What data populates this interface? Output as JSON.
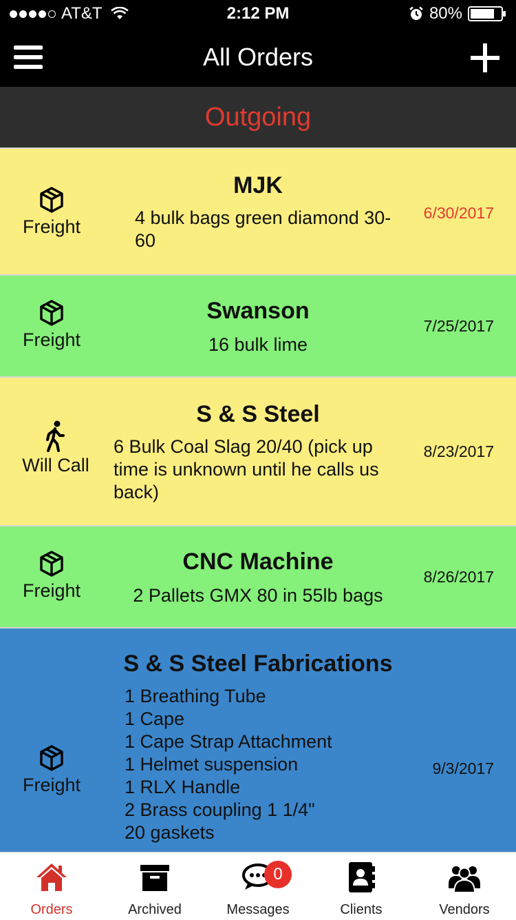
{
  "status_bar": {
    "carrier": "AT&T",
    "time": "2:12 PM",
    "battery": "80%",
    "signal_bars": 4,
    "battery_level": 0.8
  },
  "nav": {
    "title": "All Orders",
    "menu_icon": "hamburger-menu-icon",
    "add_icon": "plus-icon"
  },
  "section": {
    "title": "Outgoing"
  },
  "colors": {
    "yellow": "#fbee80",
    "green": "#85f07a",
    "blue": "#3b86cb",
    "accent_red": "#e23a2f"
  },
  "orders": [
    {
      "client": "MJK",
      "type": "Freight",
      "icon": "box-icon",
      "description": "4 bulk bags green diamond 30-60",
      "date": "6/30/2017",
      "overdue": true,
      "color": "yellow"
    },
    {
      "client": "Swanson",
      "type": "Freight",
      "icon": "box-icon",
      "description": "16 bulk lime",
      "date": "7/25/2017",
      "color": "green"
    },
    {
      "client": "S & S Steel",
      "type": "Will Call",
      "icon": "walking-person-icon",
      "description": "6 Bulk Coal Slag 20/40 (pick up time is unknown until he calls us back)",
      "date": "8/23/2017",
      "color": "yellow"
    },
    {
      "client": "CNC Machine",
      "type": "Freight",
      "icon": "box-icon",
      "description": "2 Pallets GMX 80 in 55lb bags",
      "date": "8/26/2017",
      "color": "green"
    },
    {
      "client": "S & S Steel Fabrications",
      "type": "Freight",
      "icon": "box-icon",
      "description_lines": [
        "1 Breathing Tube",
        "1 Cape",
        "1 Cape Strap Attachment",
        "1 Helmet suspension",
        "1 RLX Handle",
        "2 Brass coupling 1 1/4\"",
        "20 gaskets"
      ],
      "date": "9/3/2017",
      "color": "blue"
    }
  ],
  "tabs": [
    {
      "label": "Orders",
      "icon": "house-icon",
      "active": true
    },
    {
      "label": "Archived",
      "icon": "archive-box-icon"
    },
    {
      "label": "Messages",
      "icon": "chat-bubble-icon",
      "badge": "0"
    },
    {
      "label": "Clients",
      "icon": "contact-book-icon"
    },
    {
      "label": "Vendors",
      "icon": "people-group-icon"
    }
  ]
}
